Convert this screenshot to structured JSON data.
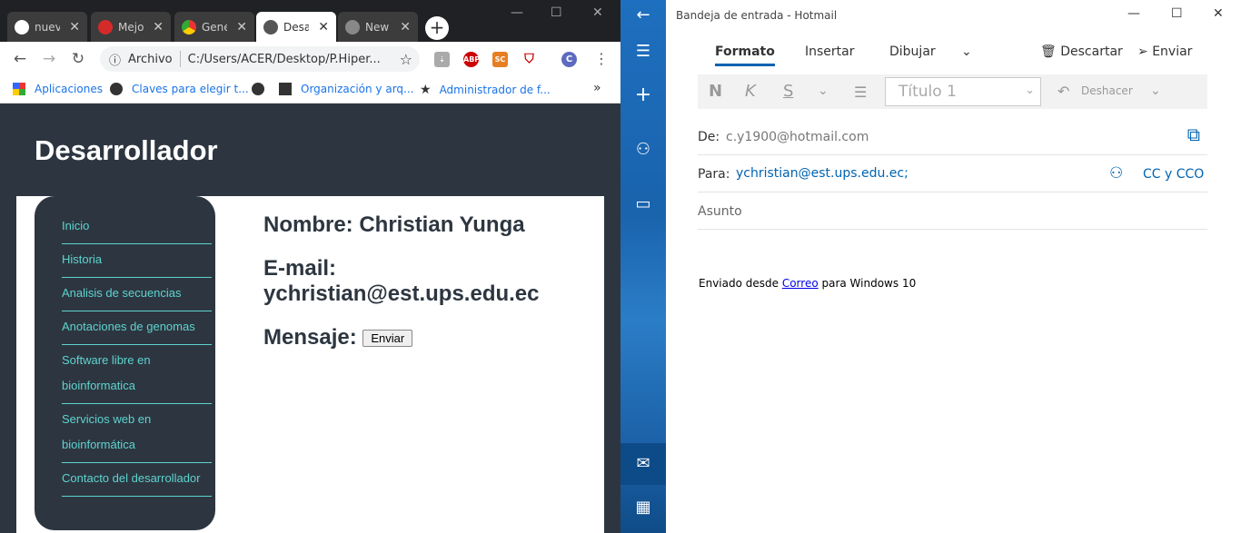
{
  "browser": {
    "tabs": [
      {
        "label": "nuev",
        "icon": "github-icon",
        "active": false
      },
      {
        "label": "Mejo",
        "icon": "opera-icon",
        "active": false
      },
      {
        "label": "Gene",
        "icon": "chrome-icon",
        "active": false
      },
      {
        "label": "Desa",
        "icon": "globe-icon",
        "active": true
      },
      {
        "label": "New",
        "icon": "globe-icon",
        "active": false
      }
    ],
    "address_prefix": "Archivo",
    "address_url": "C:/Users/ACER/Desktop/P.Hiper...",
    "extensions": [
      "ABP",
      "SC"
    ],
    "profile_initial": "C",
    "bookmarks": [
      {
        "label": "Aplicaciones",
        "icon": "apps-grid-icon"
      },
      {
        "label": "Claves para elegir t...",
        "icon": "globe-icon"
      },
      {
        "label": "Organización y arq...",
        "icon": "site-favicon-icon"
      },
      {
        "label": "Administrador de f...",
        "icon": "star-icon"
      }
    ],
    "overflow": "»"
  },
  "page": {
    "title": "Desarrollador",
    "nav": [
      "Inicio",
      "Historia",
      "Analisis de secuencias",
      "Anotaciones de genomas",
      "Software libre en bioinformatica",
      "Servicios web en bioinformática",
      "Contacto del desarrollador"
    ],
    "name_line": "Nombre: Christian Yunga",
    "email_label": "E-mail:",
    "email_value": "ychristian@est.ups.edu.ec",
    "message_label": "Mensaje:",
    "send_button": "Enviar"
  },
  "mail": {
    "window_title": "Bandeja de entrada - Hotmail",
    "ribbon_tabs": [
      "Formato",
      "Insertar",
      "Dibujar"
    ],
    "discard_label": "Descartar",
    "send_label": "Enviar",
    "format_bold": "N",
    "format_italic": "K",
    "format_underline": "S",
    "heading_style": "Título 1",
    "undo_label": "Deshacer",
    "from_label": "De:",
    "from_value": "c.y1900@hotmail.com",
    "to_label": "Para:",
    "to_value": "ychristian@est.ups.edu.ec;",
    "cc_label": "CC y CCO",
    "subject_placeholder": "Asunto",
    "signature_prefix": "Enviado desde ",
    "signature_link": "Correo",
    "signature_suffix": " para Windows 10"
  }
}
